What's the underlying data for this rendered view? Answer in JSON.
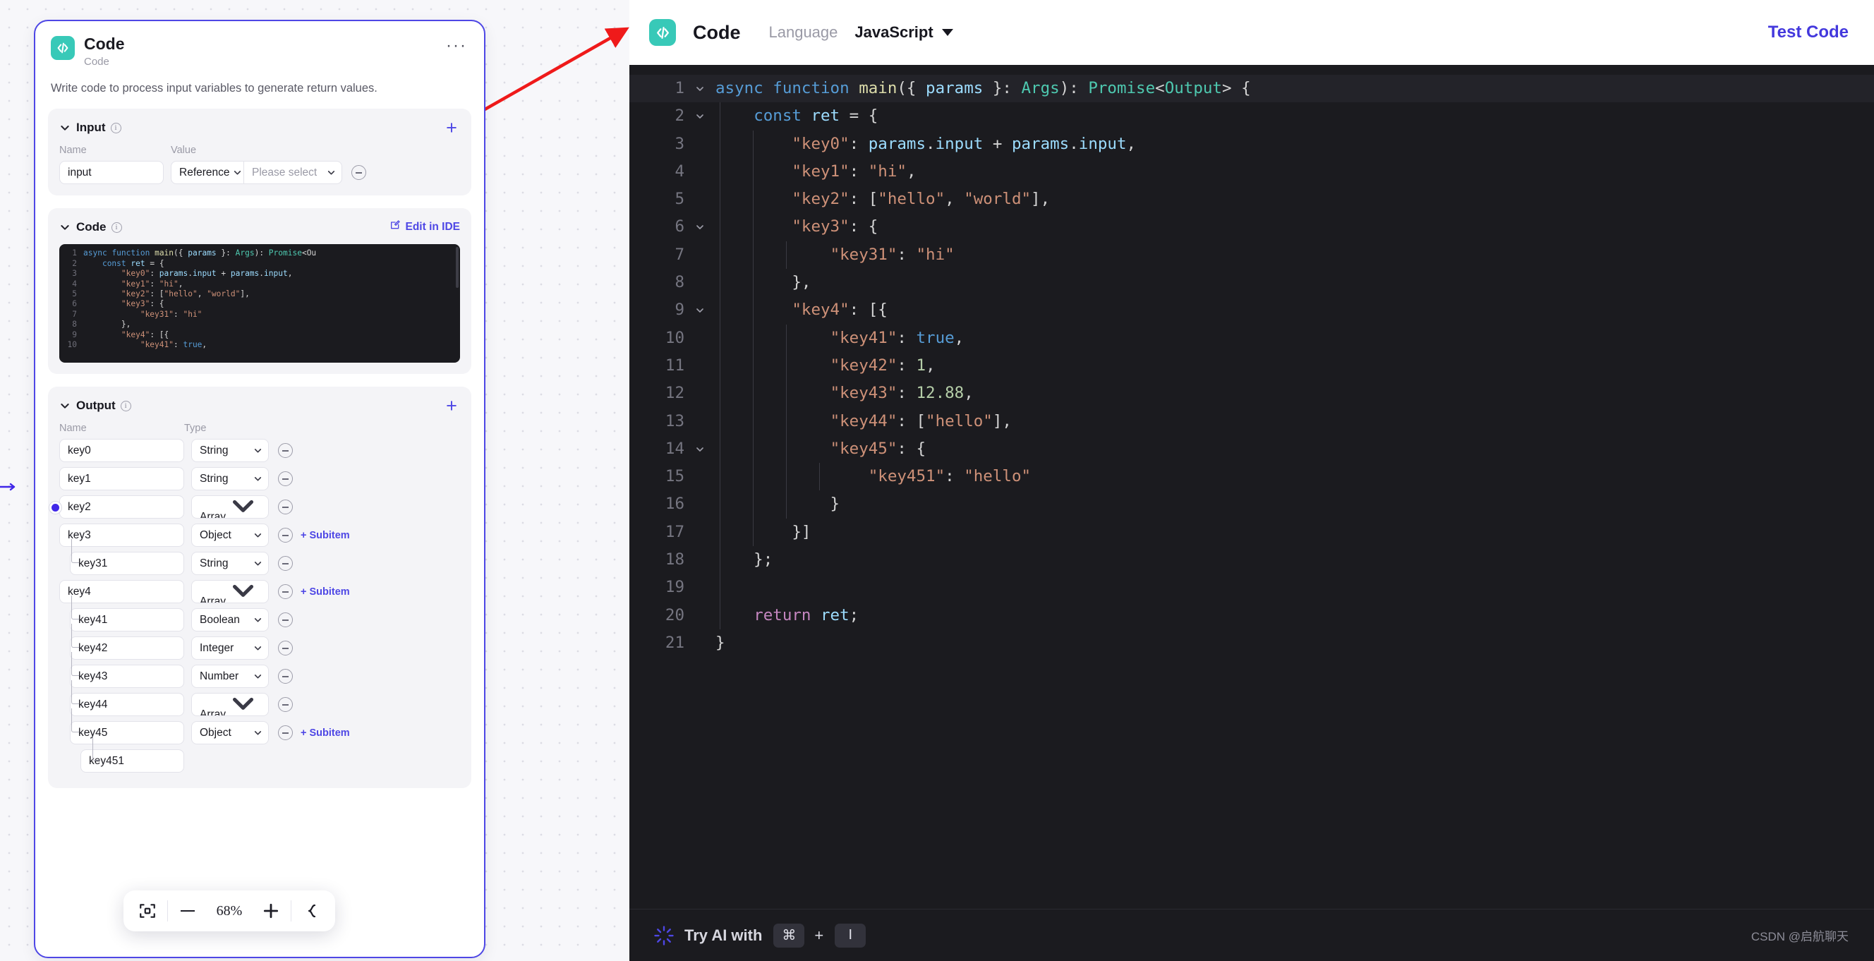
{
  "node": {
    "title": "Code",
    "subtitle": "Code",
    "description": "Write code to process input variables to generate return values.",
    "menu_label": "···",
    "icon": "code-icon",
    "accent_color": "#4e47e5",
    "icon_color": "#38c9b8"
  },
  "input_section": {
    "title": "Input",
    "add_label": "+",
    "col_name": "Name",
    "col_value": "Value",
    "rows": [
      {
        "name": "input",
        "kind": "Reference",
        "value_placeholder": "Please select"
      }
    ]
  },
  "code_section": {
    "title": "Code",
    "edit_label": "Edit in IDE",
    "lines": [
      {
        "n": "1",
        "tokens": [
          {
            "t": "kw2",
            "s": "async"
          },
          {
            "t": "pl",
            "s": " "
          },
          {
            "t": "kw2",
            "s": "function"
          },
          {
            "t": "pl",
            "s": " "
          },
          {
            "t": "fn",
            "s": "main"
          },
          {
            "t": "pl",
            "s": "({ "
          },
          {
            "t": "var",
            "s": "params"
          },
          {
            "t": "pl",
            "s": " }: "
          },
          {
            "t": "type",
            "s": "Args"
          },
          {
            "t": "pl",
            "s": "): "
          },
          {
            "t": "type",
            "s": "Promise"
          },
          {
            "t": "pl",
            "s": "<Ou"
          }
        ]
      },
      {
        "n": "2",
        "tokens": [
          {
            "t": "pl",
            "s": "    "
          },
          {
            "t": "kw2",
            "s": "const"
          },
          {
            "t": "pl",
            "s": " "
          },
          {
            "t": "var",
            "s": "ret"
          },
          {
            "t": "pl",
            "s": " = {"
          }
        ]
      },
      {
        "n": "3",
        "tokens": [
          {
            "t": "pl",
            "s": "        "
          },
          {
            "t": "str",
            "s": "\"key0\""
          },
          {
            "t": "pl",
            "s": ": "
          },
          {
            "t": "var",
            "s": "params"
          },
          {
            "t": "pl",
            "s": "."
          },
          {
            "t": "var",
            "s": "input"
          },
          {
            "t": "pl",
            "s": " + "
          },
          {
            "t": "var",
            "s": "params"
          },
          {
            "t": "pl",
            "s": "."
          },
          {
            "t": "var",
            "s": "input"
          },
          {
            "t": "pl",
            "s": ","
          }
        ]
      },
      {
        "n": "4",
        "tokens": [
          {
            "t": "pl",
            "s": "        "
          },
          {
            "t": "str",
            "s": "\"key1\""
          },
          {
            "t": "pl",
            "s": ": "
          },
          {
            "t": "str",
            "s": "\"hi\""
          },
          {
            "t": "pl",
            "s": ","
          }
        ]
      },
      {
        "n": "5",
        "tokens": [
          {
            "t": "pl",
            "s": "        "
          },
          {
            "t": "str",
            "s": "\"key2\""
          },
          {
            "t": "pl",
            "s": ": ["
          },
          {
            "t": "str",
            "s": "\"hello\""
          },
          {
            "t": "pl",
            "s": ", "
          },
          {
            "t": "str",
            "s": "\"world\""
          },
          {
            "t": "pl",
            "s": "],"
          }
        ]
      },
      {
        "n": "6",
        "tokens": [
          {
            "t": "pl",
            "s": "        "
          },
          {
            "t": "str",
            "s": "\"key3\""
          },
          {
            "t": "pl",
            "s": ": {"
          }
        ]
      },
      {
        "n": "7",
        "tokens": [
          {
            "t": "pl",
            "s": "            "
          },
          {
            "t": "str",
            "s": "\"key31\""
          },
          {
            "t": "pl",
            "s": ": "
          },
          {
            "t": "str",
            "s": "\"hi\""
          }
        ]
      },
      {
        "n": "8",
        "tokens": [
          {
            "t": "pl",
            "s": "        },"
          }
        ]
      },
      {
        "n": "9",
        "tokens": [
          {
            "t": "pl",
            "s": "        "
          },
          {
            "t": "str",
            "s": "\"key4\""
          },
          {
            "t": "pl",
            "s": ": [{"
          }
        ]
      },
      {
        "n": "10",
        "tokens": [
          {
            "t": "pl",
            "s": "            "
          },
          {
            "t": "str",
            "s": "\"key41\""
          },
          {
            "t": "pl",
            "s": ": "
          },
          {
            "t": "kw2",
            "s": "true"
          },
          {
            "t": "pl",
            "s": ","
          }
        ]
      }
    ]
  },
  "output_section": {
    "title": "Output",
    "add_label": "+",
    "col_name": "Name",
    "col_type": "Type",
    "subitem_label": "+ Subitem",
    "rows": [
      {
        "name": "key0",
        "type": "String",
        "indent": 0,
        "subitem": false
      },
      {
        "name": "key1",
        "type": "String",
        "indent": 0,
        "subitem": false
      },
      {
        "name": "key2",
        "type": "Array<Strin",
        "indent": 0,
        "subitem": false
      },
      {
        "name": "key3",
        "type": "Object",
        "indent": 0,
        "subitem": true
      },
      {
        "name": "key31",
        "type": "String",
        "indent": 1,
        "subitem": false
      },
      {
        "name": "key4",
        "type": "Array<Obje",
        "indent": 0,
        "subitem": true
      },
      {
        "name": "key41",
        "type": "Boolean",
        "indent": 1,
        "subitem": false
      },
      {
        "name": "key42",
        "type": "Integer",
        "indent": 1,
        "subitem": false
      },
      {
        "name": "key43",
        "type": "Number",
        "indent": 1,
        "subitem": false
      },
      {
        "name": "key44",
        "type": "Array<Strin",
        "indent": 1,
        "subitem": false
      },
      {
        "name": "key45",
        "type": "Object",
        "indent": 1,
        "subitem": true
      },
      {
        "name": "key451",
        "type": "",
        "indent": 2,
        "subitem": false
      }
    ]
  },
  "zoom_toolbar": {
    "fit_icon": "fit-screen-icon",
    "zoom_out_label": "−",
    "percent": "68%",
    "zoom_in_label": "+",
    "layout_icon": "auto-layout-icon"
  },
  "right_panel": {
    "title": "Code",
    "language_label": "Language",
    "language_value": "JavaScript",
    "test_button": "Test Code",
    "icon": "code-icon"
  },
  "editor": {
    "lines": [
      {
        "n": "1",
        "fold": true,
        "depth": 0,
        "active": true,
        "tokens": [
          {
            "t": "kw2",
            "s": "async"
          },
          {
            "t": "pl",
            "s": " "
          },
          {
            "t": "kw2",
            "s": "function"
          },
          {
            "t": "pl",
            "s": " "
          },
          {
            "t": "fn",
            "s": "main"
          },
          {
            "t": "pl",
            "s": "({ "
          },
          {
            "t": "var",
            "s": "params"
          },
          {
            "t": "pl",
            "s": " }: "
          },
          {
            "t": "type",
            "s": "Args"
          },
          {
            "t": "pl",
            "s": "): "
          },
          {
            "t": "type",
            "s": "Promise"
          },
          {
            "t": "pl",
            "s": "<"
          },
          {
            "t": "type",
            "s": "Output"
          },
          {
            "t": "pl",
            "s": "> {"
          }
        ]
      },
      {
        "n": "2",
        "fold": true,
        "depth": 1,
        "active": false,
        "tokens": [
          {
            "t": "pl",
            "s": "    "
          },
          {
            "t": "kw2",
            "s": "const"
          },
          {
            "t": "pl",
            "s": " "
          },
          {
            "t": "var",
            "s": "ret"
          },
          {
            "t": "pl",
            "s": " = {"
          }
        ]
      },
      {
        "n": "3",
        "fold": false,
        "depth": 2,
        "active": false,
        "tokens": [
          {
            "t": "pl",
            "s": "        "
          },
          {
            "t": "str",
            "s": "\"key0\""
          },
          {
            "t": "pl",
            "s": ": "
          },
          {
            "t": "var",
            "s": "params"
          },
          {
            "t": "pl",
            "s": "."
          },
          {
            "t": "var",
            "s": "input"
          },
          {
            "t": "pl",
            "s": " + "
          },
          {
            "t": "var",
            "s": "params"
          },
          {
            "t": "pl",
            "s": "."
          },
          {
            "t": "var",
            "s": "input"
          },
          {
            "t": "pl",
            "s": ","
          }
        ]
      },
      {
        "n": "4",
        "fold": false,
        "depth": 2,
        "active": false,
        "tokens": [
          {
            "t": "pl",
            "s": "        "
          },
          {
            "t": "str",
            "s": "\"key1\""
          },
          {
            "t": "pl",
            "s": ": "
          },
          {
            "t": "str",
            "s": "\"hi\""
          },
          {
            "t": "pl",
            "s": ","
          }
        ]
      },
      {
        "n": "5",
        "fold": false,
        "depth": 2,
        "active": false,
        "tokens": [
          {
            "t": "pl",
            "s": "        "
          },
          {
            "t": "str",
            "s": "\"key2\""
          },
          {
            "t": "pl",
            "s": ": ["
          },
          {
            "t": "str",
            "s": "\"hello\""
          },
          {
            "t": "pl",
            "s": ", "
          },
          {
            "t": "str",
            "s": "\"world\""
          },
          {
            "t": "pl",
            "s": "],"
          }
        ]
      },
      {
        "n": "6",
        "fold": true,
        "depth": 2,
        "active": false,
        "tokens": [
          {
            "t": "pl",
            "s": "        "
          },
          {
            "t": "str",
            "s": "\"key3\""
          },
          {
            "t": "pl",
            "s": ": {"
          }
        ]
      },
      {
        "n": "7",
        "fold": false,
        "depth": 3,
        "active": false,
        "tokens": [
          {
            "t": "pl",
            "s": "            "
          },
          {
            "t": "str",
            "s": "\"key31\""
          },
          {
            "t": "pl",
            "s": ": "
          },
          {
            "t": "str",
            "s": "\"hi\""
          }
        ]
      },
      {
        "n": "8",
        "fold": false,
        "depth": 2,
        "active": false,
        "tokens": [
          {
            "t": "pl",
            "s": "        },"
          }
        ]
      },
      {
        "n": "9",
        "fold": true,
        "depth": 2,
        "active": false,
        "tokens": [
          {
            "t": "pl",
            "s": "        "
          },
          {
            "t": "str",
            "s": "\"key4\""
          },
          {
            "t": "pl",
            "s": ": [{"
          }
        ]
      },
      {
        "n": "10",
        "fold": false,
        "depth": 3,
        "active": false,
        "tokens": [
          {
            "t": "pl",
            "s": "            "
          },
          {
            "t": "str",
            "s": "\"key41\""
          },
          {
            "t": "pl",
            "s": ": "
          },
          {
            "t": "kw2",
            "s": "true"
          },
          {
            "t": "pl",
            "s": ","
          }
        ]
      },
      {
        "n": "11",
        "fold": false,
        "depth": 3,
        "active": false,
        "tokens": [
          {
            "t": "pl",
            "s": "            "
          },
          {
            "t": "str",
            "s": "\"key42\""
          },
          {
            "t": "pl",
            "s": ": "
          },
          {
            "t": "num",
            "s": "1"
          },
          {
            "t": "pl",
            "s": ","
          }
        ]
      },
      {
        "n": "12",
        "fold": false,
        "depth": 3,
        "active": false,
        "tokens": [
          {
            "t": "pl",
            "s": "            "
          },
          {
            "t": "str",
            "s": "\"key43\""
          },
          {
            "t": "pl",
            "s": ": "
          },
          {
            "t": "num",
            "s": "12.88"
          },
          {
            "t": "pl",
            "s": ","
          }
        ]
      },
      {
        "n": "13",
        "fold": false,
        "depth": 3,
        "active": false,
        "tokens": [
          {
            "t": "pl",
            "s": "            "
          },
          {
            "t": "str",
            "s": "\"key44\""
          },
          {
            "t": "pl",
            "s": ": ["
          },
          {
            "t": "str",
            "s": "\"hello\""
          },
          {
            "t": "pl",
            "s": "],"
          }
        ]
      },
      {
        "n": "14",
        "fold": true,
        "depth": 3,
        "active": false,
        "tokens": [
          {
            "t": "pl",
            "s": "            "
          },
          {
            "t": "str",
            "s": "\"key45\""
          },
          {
            "t": "pl",
            "s": ": {"
          }
        ]
      },
      {
        "n": "15",
        "fold": false,
        "depth": 4,
        "active": false,
        "tokens": [
          {
            "t": "pl",
            "s": "                "
          },
          {
            "t": "str",
            "s": "\"key451\""
          },
          {
            "t": "pl",
            "s": ": "
          },
          {
            "t": "str",
            "s": "\"hello\""
          }
        ]
      },
      {
        "n": "16",
        "fold": false,
        "depth": 3,
        "active": false,
        "tokens": [
          {
            "t": "pl",
            "s": "            }"
          }
        ]
      },
      {
        "n": "17",
        "fold": false,
        "depth": 2,
        "active": false,
        "tokens": [
          {
            "t": "pl",
            "s": "        }]"
          }
        ]
      },
      {
        "n": "18",
        "fold": false,
        "depth": 1,
        "active": false,
        "tokens": [
          {
            "t": "pl",
            "s": "    };"
          }
        ]
      },
      {
        "n": "19",
        "fold": false,
        "depth": 1,
        "active": false,
        "tokens": [
          {
            "t": "pl",
            "s": ""
          }
        ]
      },
      {
        "n": "20",
        "fold": false,
        "depth": 1,
        "active": false,
        "tokens": [
          {
            "t": "pl",
            "s": "    "
          },
          {
            "t": "kw",
            "s": "return"
          },
          {
            "t": "pl",
            "s": " "
          },
          {
            "t": "var",
            "s": "ret"
          },
          {
            "t": "pl",
            "s": ";"
          }
        ]
      },
      {
        "n": "21",
        "fold": false,
        "depth": 0,
        "active": false,
        "tokens": [
          {
            "t": "pl",
            "s": "}"
          }
        ]
      }
    ]
  },
  "ai_bar": {
    "label": "Try AI with",
    "key1": "⌘",
    "plus": "+",
    "key2": "I",
    "icon": "sparkle-icon"
  },
  "watermark": "CSDN @启航聊天"
}
